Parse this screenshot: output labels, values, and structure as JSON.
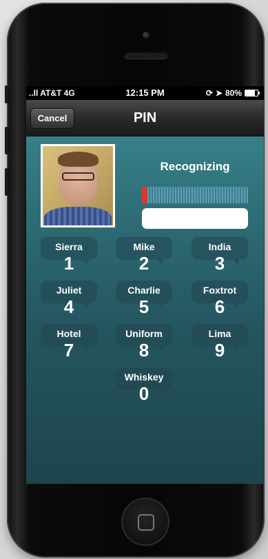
{
  "status_bar": {
    "carrier": "..ll AT&T 4G",
    "time": "12:15 PM",
    "battery": "80%",
    "battery_level": 0.8
  },
  "nav": {
    "cancel_label": "Cancel",
    "title": "PIN"
  },
  "recognition": {
    "status_text": "Recognizing",
    "progress": 0.05,
    "input_value": ""
  },
  "keypad": [
    {
      "word": "Sierra",
      "digit": "1"
    },
    {
      "word": "Mike",
      "digit": "2"
    },
    {
      "word": "India",
      "digit": "3"
    },
    {
      "word": "Juliet",
      "digit": "4"
    },
    {
      "word": "Charlie",
      "digit": "5"
    },
    {
      "word": "Foxtrot",
      "digit": "6"
    },
    {
      "word": "Hotel",
      "digit": "7"
    },
    {
      "word": "Uniform",
      "digit": "8"
    },
    {
      "word": "Lima",
      "digit": "9"
    },
    {
      "word": "Whiskey",
      "digit": "0"
    }
  ],
  "colors": {
    "screen_top": "#3d8c95",
    "screen_bottom": "#1e444c",
    "progress_fill": "#d73b2f",
    "navbar": "#2a2a2a"
  },
  "icons": [
    "signal-icon",
    "rotation-lock-icon",
    "location-arrow-icon",
    "battery-icon",
    "home-button-icon"
  ]
}
